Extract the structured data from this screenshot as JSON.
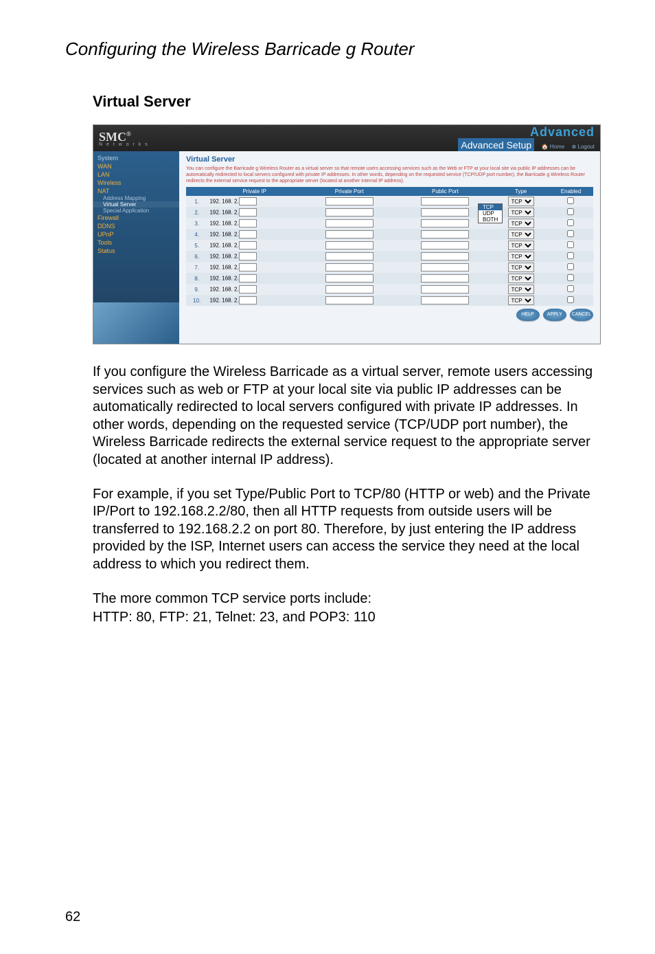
{
  "doc": {
    "title": "Configuring the Wireless Barricade g Router",
    "section": "Virtual Server",
    "page_number": "62",
    "para1": "If you configure the Wireless Barricade as a virtual server, remote users accessing services such as web or FTP at your local site via public IP addresses can be automatically redirected to local servers configured with private IP addresses. In other words, depending on the requested service (TCP/UDP port number), the Wireless Barricade redirects the external service request to the appropriate server (located at another internal IP address).",
    "para2": "For example, if you set Type/Public Port to TCP/80 (HTTP or web) and the Private IP/Port to 192.168.2.2/80, then all HTTP requests from outside users will be transferred to 192.168.2.2 on port 80. Therefore, by just entering the IP address provided by the ISP, Internet users can access the service they need at the local address to which you redirect them.",
    "para3": "The more common TCP service ports include:",
    "para4": "HTTP: 80, FTP: 21, Telnet: 23, and POP3: 110"
  },
  "shot": {
    "logo": "SMC",
    "logo_sub": "N e t w o r k s",
    "brand_right": "Advanced",
    "setup_label": "Advanced Setup",
    "home_link": "Home",
    "logout_link": "Logout",
    "sidebar": {
      "items": [
        {
          "label": "System",
          "active": false
        },
        {
          "label": "WAN",
          "active": true
        },
        {
          "label": "LAN",
          "active": true
        },
        {
          "label": "Wireless",
          "active": true
        },
        {
          "label": "NAT",
          "active": true
        },
        {
          "label": "Firewall",
          "active": true
        },
        {
          "label": "DDNS",
          "active": true
        },
        {
          "label": "UPnP",
          "active": true
        },
        {
          "label": "Tools",
          "active": true
        },
        {
          "label": "Status",
          "active": true
        }
      ],
      "subitems": [
        {
          "label": "Address Mapping",
          "selected": false
        },
        {
          "label": "Virtual Server",
          "selected": true
        },
        {
          "label": "Special Application",
          "selected": false
        }
      ]
    },
    "main": {
      "heading": "Virtual Server",
      "desc": "You can configure the Barricade g Wireless Router as a virtual server so that remote users accessing services such as the Web or FTP at your local site via public IP addresses can be automatically redirected to local servers configured with private IP addresses. In other words, depending on the requested service (TCP/UDP port number), the Barricade g Wireless Router redirects the external service request to the appropriate server (located at another internal IP address).",
      "columns": {
        "idx": "",
        "private_ip": "Private IP",
        "private_port": "Private Port",
        "public_port": "Public Port",
        "type": "Type",
        "enabled": "Enabled"
      },
      "ip_prefix": "192. 168. 2.",
      "type_options": [
        "TCP",
        "UDP",
        "BOTH"
      ],
      "type_selected": "TCP",
      "row_count": 10,
      "buttons": {
        "help": "HELP",
        "apply": "APPLY",
        "cancel": "CANCEL"
      }
    }
  }
}
